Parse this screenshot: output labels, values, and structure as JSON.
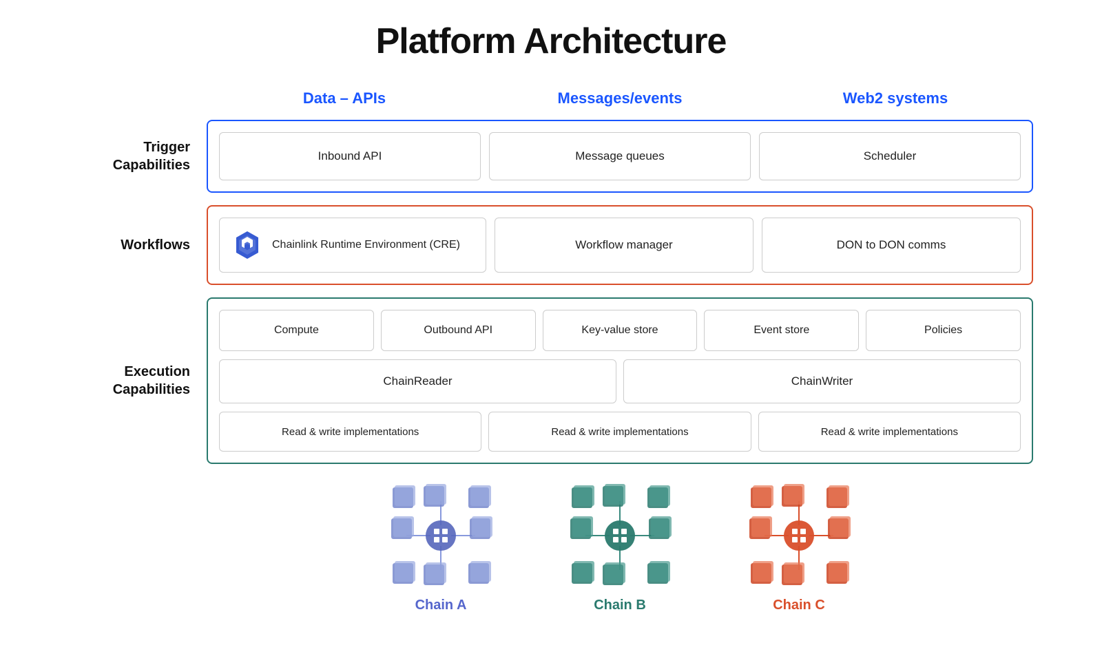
{
  "title": "Platform Architecture",
  "columns": {
    "header1": "Data – APIs",
    "header2": "Messages/events",
    "header3": "Web2 systems"
  },
  "rows": {
    "trigger": {
      "label": "Trigger\nCapabilities",
      "cells": [
        "Inbound API",
        "Message queues",
        "Scheduler"
      ]
    },
    "workflows": {
      "label": "Workflows",
      "cre_text": "Chainlink Runtime Environment (CRE)",
      "cell2": "Workflow manager",
      "cell3": "DON to DON comms"
    },
    "execution": {
      "label": "Execution\nCapabilities",
      "row1": [
        "Compute",
        "Outbound API",
        "Key-value store",
        "Event store",
        "Policies"
      ],
      "row2_left": "ChainReader",
      "row2_right": "ChainWriter",
      "row3": [
        "Read & write implementations",
        "Read & write implementations",
        "Read & write implementations"
      ]
    }
  },
  "chains": [
    {
      "label": "Chain A",
      "color_class": "chain-label-a",
      "cube_color": "#5b6bbf"
    },
    {
      "label": "Chain B",
      "color_class": "chain-label-b",
      "cube_color": "#2a7a6e"
    },
    {
      "label": "Chain C",
      "color_class": "chain-label-c",
      "cube_color": "#d94f2b"
    }
  ]
}
